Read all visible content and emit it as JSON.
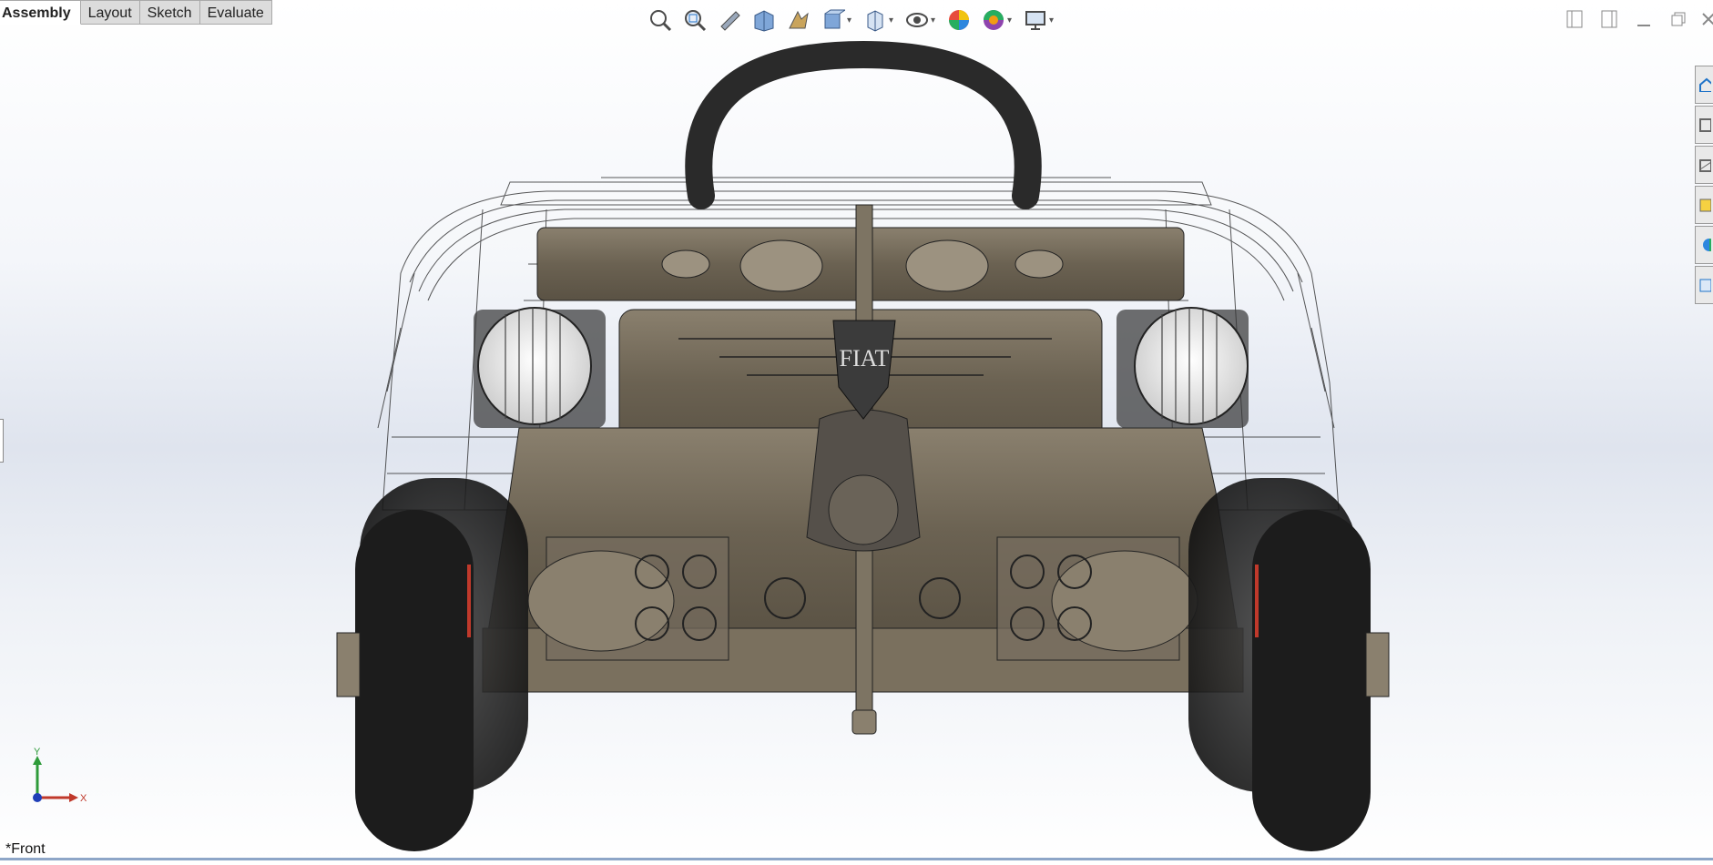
{
  "tabs": [
    {
      "label": "Assembly",
      "active": true
    },
    {
      "label": "Layout",
      "active": false
    },
    {
      "label": "Sketch",
      "active": false
    },
    {
      "label": "Evaluate",
      "active": false
    }
  ],
  "hud_toolbar": [
    {
      "icon": "zoom-to-fit-icon"
    },
    {
      "icon": "zoom-to-area-icon"
    },
    {
      "icon": "previous-view-icon"
    },
    {
      "icon": "section-view-icon"
    },
    {
      "icon": "dynamic-annotation-views-icon"
    },
    {
      "icon": "view-orientation-icon",
      "dropdown": true
    },
    {
      "icon": "display-style-icon",
      "dropdown": true
    },
    {
      "icon": "hide-show-items-icon",
      "dropdown": true
    },
    {
      "icon": "edit-appearance-icon"
    },
    {
      "icon": "apply-scene-icon",
      "dropdown": true
    },
    {
      "icon": "view-settings-icon",
      "dropdown": true
    }
  ],
  "window_controls": [
    "tile-left-icon",
    "tile-right-icon",
    "minimize-icon",
    "restore-icon",
    "close-icon"
  ],
  "task_pane": [
    "resources-icon",
    "design-library-icon",
    "file-explorer-icon",
    "view-palette-icon",
    "appearances-icon",
    "custom-properties-icon"
  ],
  "model": {
    "grille_badge": "FIAT"
  },
  "triad": {
    "y_label": "Y",
    "x_label": "X"
  },
  "view_name": "*Front",
  "colors": {
    "accent": "#1f73c8",
    "chassis": "#6f6555",
    "tire": "#222222"
  }
}
